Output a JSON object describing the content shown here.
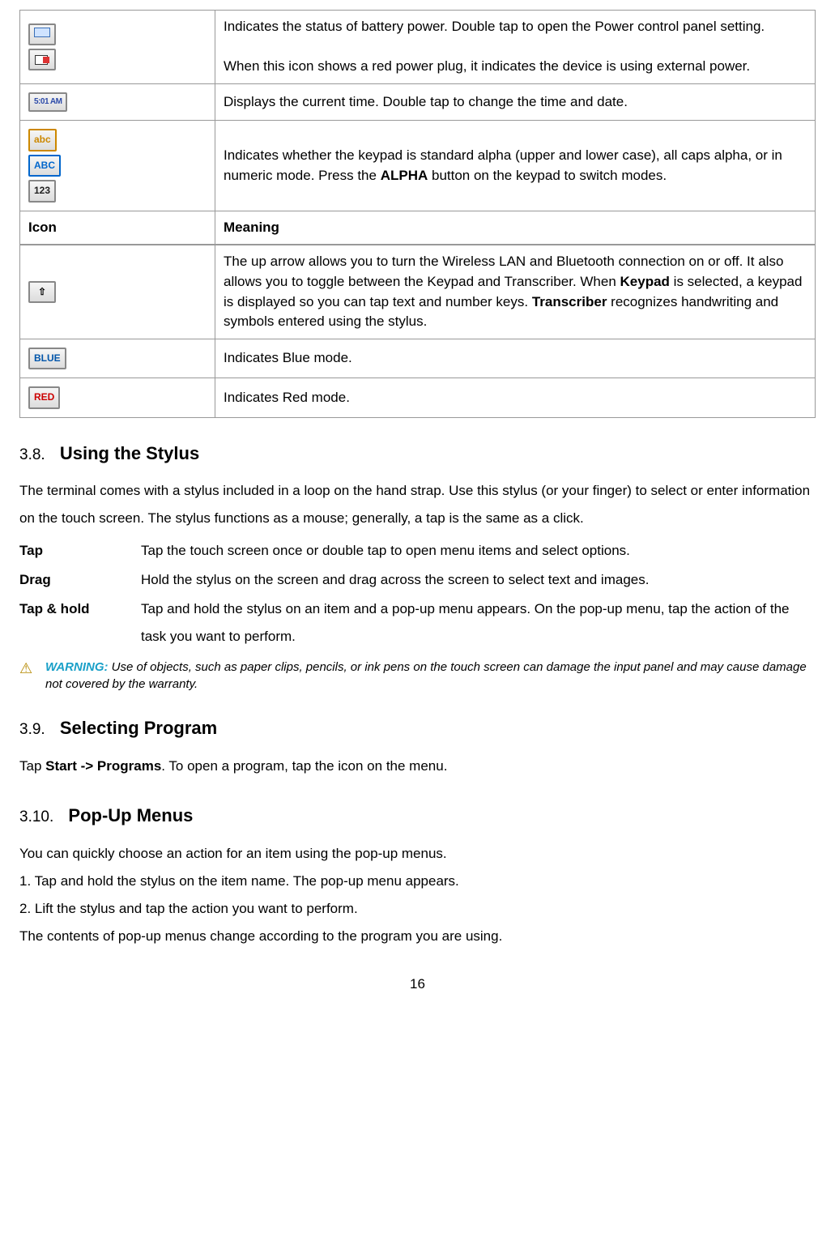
{
  "table1": {
    "rows": [
      {
        "icons": [
          "battery",
          "plug"
        ],
        "meaning_parts": [
          "Indicates the status of battery power. Double tap to open the Power control panel setting.",
          "When this icon shows a red power plug, it indicates the device is using external power."
        ]
      },
      {
        "icons": [
          "time"
        ],
        "time_text": "5:01 AM",
        "meaning": "Displays the current time. Double tap to change the time and date."
      },
      {
        "icons": [
          "abc-lower",
          "abc-upper",
          "num"
        ],
        "abc_lower": "abc",
        "abc_upper": "ABC",
        "num": "123",
        "meaning_pre": "Indicates whether the keypad is standard alpha (upper and lower case), all caps alpha, or in numeric mode. Press the ",
        "meaning_bold": "ALPHA",
        "meaning_post": " button on the keypad to switch modes."
      }
    ],
    "header": {
      "icon": "Icon",
      "meaning": "Meaning"
    },
    "rows2": [
      {
        "icon": "uparrow",
        "arrow_char": "⇧",
        "meaning_pre": "The up arrow allows you to turn the Wireless LAN and Bluetooth connection on or off. It also allows you to toggle between the Keypad and Transcriber. When ",
        "bold1": "Keypad",
        "mid": " is selected, a keypad is displayed so you can tap text and number keys. ",
        "bold2": "Transcriber",
        "post": " recognizes handwriting and symbols entered using the stylus."
      },
      {
        "icon": "blue",
        "label": "BLUE",
        "meaning": "Indicates Blue mode."
      },
      {
        "icon": "red",
        "label": "RED",
        "meaning": "Indicates Red mode."
      }
    ]
  },
  "sec38": {
    "num": "3.8.",
    "title": "Using the Stylus",
    "para": "The terminal comes with a stylus included in a loop on the hand strap. Use this stylus (or your finger) to select or enter information on the touch screen. The stylus functions as a mouse; generally, a tap is the same as a click.",
    "defs": [
      {
        "term": "Tap",
        "desc": "Tap the touch screen once or double tap to open menu items and select options."
      },
      {
        "term": "Drag",
        "desc": "Hold the stylus on the screen and drag across the screen to select text and images."
      },
      {
        "term": "Tap & hold",
        "desc": "Tap and hold the stylus on an item and a pop-up menu appears. On the pop-up menu, tap the action of the task you want to perform."
      }
    ],
    "warning_label": "WARNING:",
    "warning_text": " Use of objects, such as paper clips, pencils, or ink pens on the touch screen can damage the input panel and may cause damage not covered by the warranty."
  },
  "sec39": {
    "num": "3.9.",
    "title": "Selecting Program",
    "pre": "Tap ",
    "bold": "Start -> Programs",
    "post": ". To open a program, tap the icon on the menu."
  },
  "sec310": {
    "num": "3.10.",
    "title": "Pop-Up Menus",
    "lines": [
      "You can quickly choose an action for an item using the pop-up menus.",
      "1. Tap and hold the stylus on the item name. The pop-up menu appears.",
      "2. Lift the stylus and tap the action you want to perform.",
      "The contents of pop-up menus change according to the program you are using."
    ]
  },
  "page_number": "16"
}
